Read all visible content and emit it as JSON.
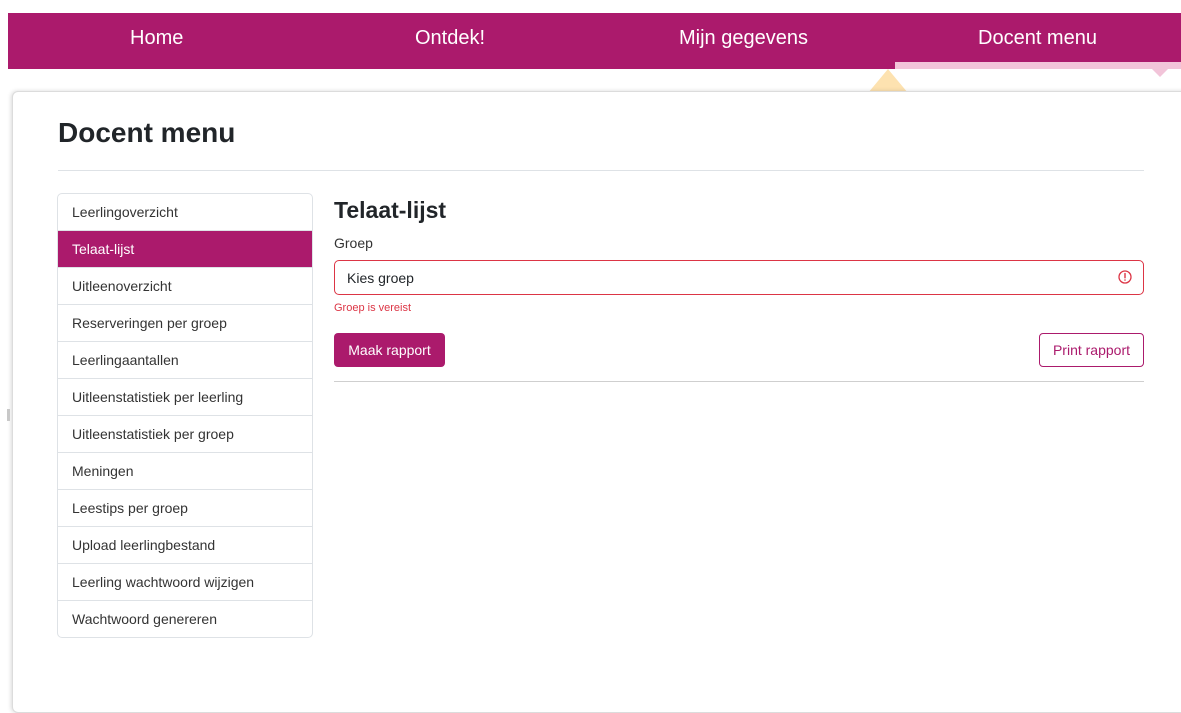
{
  "nav": {
    "items": [
      {
        "label": "Home"
      },
      {
        "label": "Ontdek!"
      },
      {
        "label": "Mijn gegevens"
      },
      {
        "label": "Docent menu"
      }
    ],
    "active": "Docent menu",
    "color": "#ab1a6c"
  },
  "page": {
    "title": "Docent menu"
  },
  "sidebar": {
    "items": [
      {
        "label": "Leerlingoverzicht"
      },
      {
        "label": "Telaat-lijst"
      },
      {
        "label": "Uitleenoverzicht"
      },
      {
        "label": "Reserveringen per groep"
      },
      {
        "label": "Leerlingaantallen"
      },
      {
        "label": "Uitleenstatistiek per leerling"
      },
      {
        "label": "Uitleenstatistiek per groep"
      },
      {
        "label": "Meningen"
      },
      {
        "label": "Leestips per groep"
      },
      {
        "label": "Upload leerlingbestand"
      },
      {
        "label": "Leerling wachtwoord wijzigen"
      },
      {
        "label": "Wachtwoord genereren"
      }
    ],
    "active": "Telaat-lijst"
  },
  "form": {
    "title": "Telaat-lijst",
    "group_label": "Groep",
    "group_value": "Kies groep",
    "error": "Groep is vereist",
    "make_report_label": "Maak rapport",
    "print_report_label": "Print rapport",
    "error_color": "#dc3545"
  }
}
